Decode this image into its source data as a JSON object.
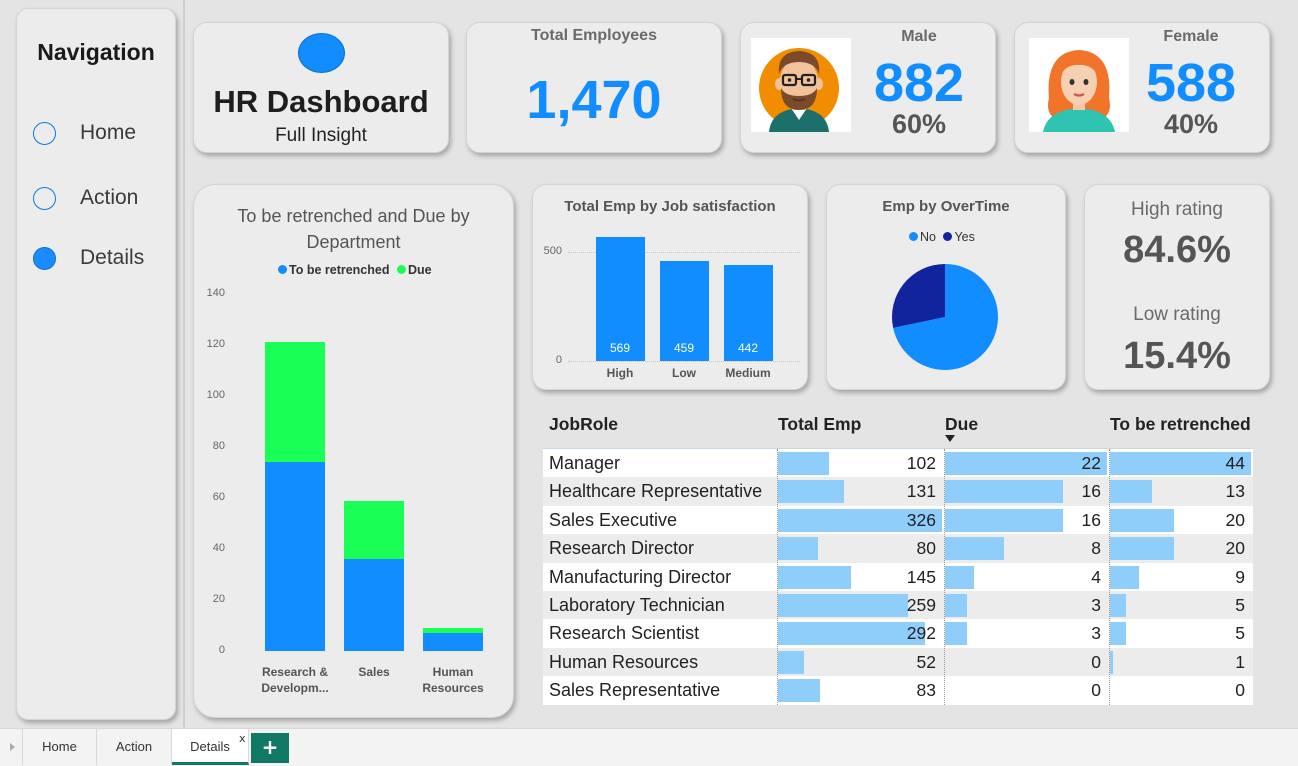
{
  "nav": {
    "title": "Navigation",
    "items": [
      {
        "label": "Home",
        "active": false
      },
      {
        "label": "Action",
        "active": false
      },
      {
        "label": "Details",
        "active": true
      }
    ]
  },
  "header": {
    "title": "HR Dashboard",
    "subtitle": "Full Insight"
  },
  "kpi": {
    "total_employees": {
      "label": "Total Employees",
      "value": "1,470"
    },
    "male": {
      "label": "Male",
      "value": "882",
      "pct": "60%"
    },
    "female": {
      "label": "Female",
      "value": "588",
      "pct": "40%"
    }
  },
  "rating": {
    "high_label": "High rating",
    "high_value": "84.6%",
    "low_label": "Low rating",
    "low_value": "15.4%"
  },
  "colors": {
    "accent_blue": "#118dff",
    "green": "#1aff55",
    "dark_navy": "#12239e",
    "table_bar": "#8fcdfa",
    "tab_green": "#117865"
  },
  "chart_data": [
    {
      "type": "bar",
      "stacked": true,
      "title": "To be retrenched and Due by Department",
      "categories": [
        "Research & Developm...",
        "Sales",
        "Human Resources"
      ],
      "series": [
        {
          "name": "To be retrenched",
          "color": "#118dff",
          "values": [
            74,
            36,
            7
          ]
        },
        {
          "name": "Due",
          "color": "#1aff55",
          "values": [
            47,
            23,
            2
          ]
        }
      ],
      "yticks": [
        "0",
        "20",
        "40",
        "60",
        "80",
        "100",
        "120",
        "140"
      ],
      "ylim": [
        0,
        140
      ],
      "legend": "top"
    },
    {
      "type": "bar",
      "title": "Total Emp by Job satisfaction",
      "categories": [
        "High",
        "Low",
        "Medium"
      ],
      "values": [
        569,
        459,
        442
      ],
      "value_labels": [
        "569",
        "459",
        "442"
      ],
      "yticks": [
        "0",
        "500"
      ],
      "ylim": [
        0,
        650
      ],
      "color": "#118dff"
    },
    {
      "type": "pie",
      "title": "Emp by OverTime",
      "labels": [
        "No",
        "Yes"
      ],
      "values": [
        1054,
        416
      ],
      "colors": [
        "#118dff",
        "#12239e"
      ],
      "legend": "top"
    },
    {
      "type": "table",
      "columns": [
        "JobRole",
        "Total Emp",
        "Due",
        "To be retrenched"
      ],
      "rows": [
        {
          "role": "Manager",
          "total": "102",
          "due": "22",
          "retrenched": "44"
        },
        {
          "role": "Healthcare Representative",
          "total": "131",
          "due": "16",
          "retrenched": "13"
        },
        {
          "role": "Sales Executive",
          "total": "326",
          "due": "16",
          "retrenched": "20"
        },
        {
          "role": "Research Director",
          "total": "80",
          "due": "8",
          "retrenched": "20"
        },
        {
          "role": "Manufacturing Director",
          "total": "145",
          "due": "4",
          "retrenched": "9"
        },
        {
          "role": "Laboratory Technician",
          "total": "259",
          "due": "3",
          "retrenched": "5"
        },
        {
          "role": "Research Scientist",
          "total": "292",
          "due": "3",
          "retrenched": "5"
        },
        {
          "role": "Human Resources",
          "total": "52",
          "due": "0",
          "retrenched": "1"
        },
        {
          "role": "Sales Representative",
          "total": "83",
          "due": "0",
          "retrenched": "0"
        }
      ],
      "sorted_column": "Due",
      "sort_direction": "descending"
    }
  ],
  "tabs": {
    "items": [
      {
        "label": "Home",
        "active": false
      },
      {
        "label": "Action",
        "active": false
      },
      {
        "label": "Details",
        "active": true
      }
    ],
    "close_label": "x",
    "add_label": "+"
  }
}
